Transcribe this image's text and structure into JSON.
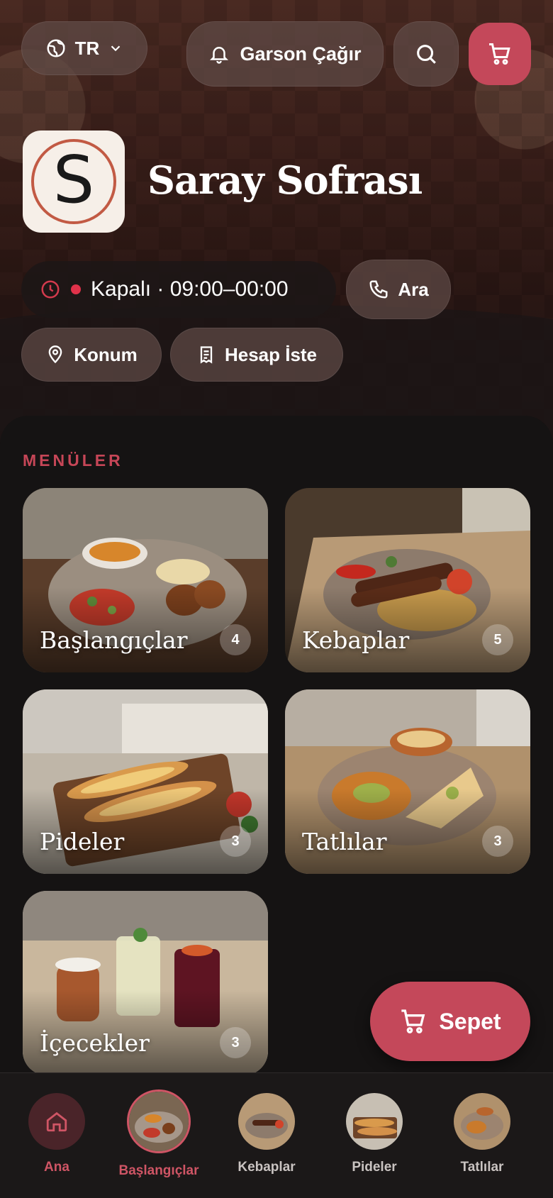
{
  "header": {
    "language": "TR",
    "waiter_label": "Garson Çağır",
    "restaurant_name": "Saray Sofrası",
    "logo_letter": "S",
    "status_text": "Kapalı · 09:00–00:00",
    "call_label": "Ara",
    "location_label": "Konum",
    "bill_label": "Hesap İste"
  },
  "menus": {
    "section_title": "MENÜLER",
    "items": [
      {
        "name": "Başlangıçlar",
        "count": "4"
      },
      {
        "name": "Kebaplar",
        "count": "5"
      },
      {
        "name": "Pideler",
        "count": "3"
      },
      {
        "name": "Tatlılar",
        "count": "3"
      },
      {
        "name": "İçecekler",
        "count": "3"
      }
    ]
  },
  "cart_button": {
    "label": "Sepet"
  },
  "bottom_nav": {
    "items": [
      {
        "label": "Ana"
      },
      {
        "label": "Başlangıçlar"
      },
      {
        "label": "Kebaplar"
      },
      {
        "label": "Pideler"
      },
      {
        "label": "Tatlılar"
      }
    ]
  },
  "colors": {
    "accent": "#c4485a",
    "status_dot": "#e0324a",
    "section": "#c64657"
  }
}
